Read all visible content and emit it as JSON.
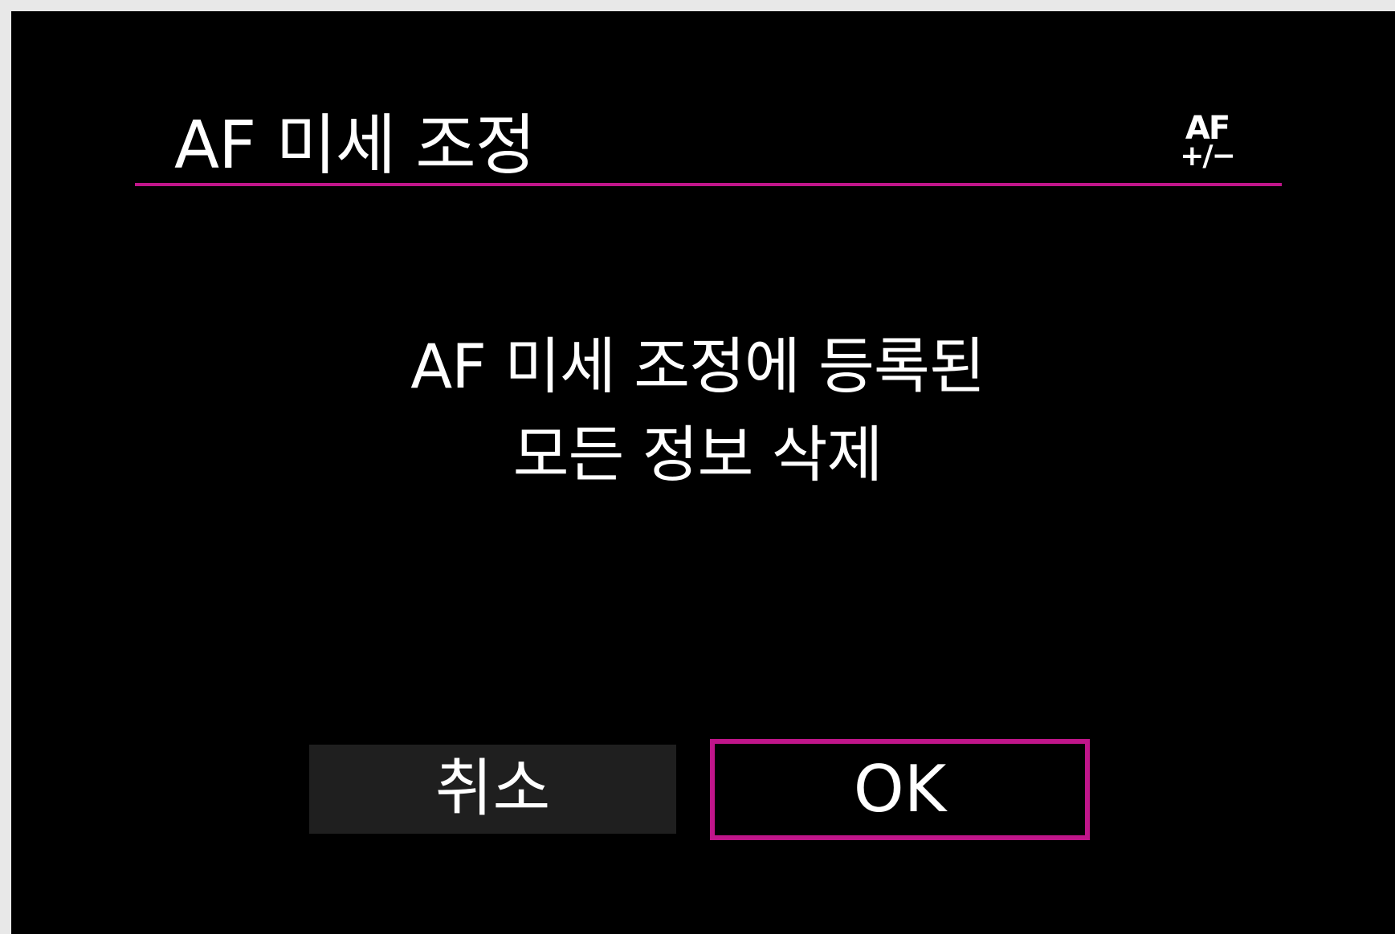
{
  "header": {
    "title": "AF 미세 조정",
    "icon": {
      "name": "af-microadjust-icon",
      "top": "AF",
      "bottom": "+/−"
    }
  },
  "dialog": {
    "message_lines": [
      "AF 미세 조정에 등록된",
      "모든 정보 삭제"
    ]
  },
  "buttons": {
    "cancel_label": "취소",
    "ok_label": "OK",
    "selected": "ok"
  },
  "colors": {
    "background": "#000000",
    "accent": "#c0158a",
    "button_inactive": "#1f1f1f",
    "text": "#ffffff"
  }
}
